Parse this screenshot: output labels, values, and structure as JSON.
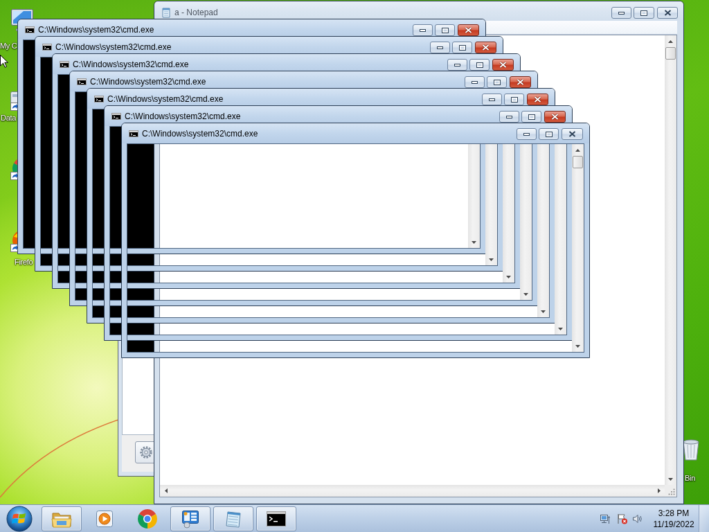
{
  "desktop_icons": [
    {
      "kind": "computer",
      "label": "My C"
    },
    {
      "kind": "shortcut",
      "label": "Data"
    },
    {
      "kind": "chrome"
    },
    {
      "kind": "firefox",
      "label": "Firefo"
    },
    {
      "kind": "bin",
      "label": "Bin"
    }
  ],
  "notepad": {
    "title": "a - Notepad",
    "active": false
  },
  "console_windows": [
    {
      "title": "C:\\Windows\\system32\\cmd.exe",
      "active": true
    },
    {
      "title": "C:\\Windows\\system32\\cmd.exe",
      "active": true
    },
    {
      "title": "C:\\Windows\\system32\\cmd.exe",
      "active": true
    },
    {
      "title": "C:\\Windows\\system32\\cmd.exe",
      "active": true
    },
    {
      "title": "C:\\Windows\\system32\\cmd.exe",
      "active": true
    },
    {
      "title": "C:\\Windows\\system32\\cmd.exe",
      "active": true
    },
    {
      "title": "C:\\Windows\\system32\\cmd.exe",
      "active": false
    }
  ],
  "taskbar": {
    "pinned": [
      {
        "kind": "folder",
        "running": true
      },
      {
        "kind": "media",
        "running": false
      },
      {
        "kind": "chrome",
        "running": false
      },
      {
        "kind": "panel",
        "running": true
      },
      {
        "kind": "notepad",
        "running": true
      },
      {
        "kind": "console",
        "running": true
      }
    ],
    "tray": [
      {
        "kind": "network"
      },
      {
        "kind": "flag"
      },
      {
        "kind": "volume"
      }
    ],
    "clock": {
      "time": "3:28 PM",
      "date": "11/19/2022"
    }
  }
}
